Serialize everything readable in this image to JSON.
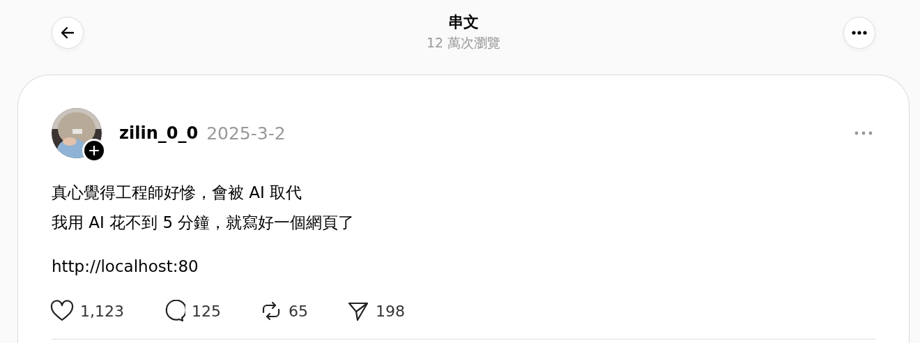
{
  "header": {
    "title": "串文",
    "subtitle": "12 萬次瀏覽"
  },
  "post": {
    "username": "zilin_0_0",
    "date": "2025-3-2",
    "lines": [
      "真心覺得工程師好慘，會被 AI 取代",
      "我用 AI 花不到 5 分鐘，就寫好一個網頁了"
    ],
    "link": "http://localhost:80",
    "actions": [
      {
        "kind": "like",
        "count": "1,123"
      },
      {
        "kind": "comment",
        "count": "125"
      },
      {
        "kind": "repost",
        "count": "65"
      },
      {
        "kind": "share",
        "count": "198"
      }
    ]
  }
}
